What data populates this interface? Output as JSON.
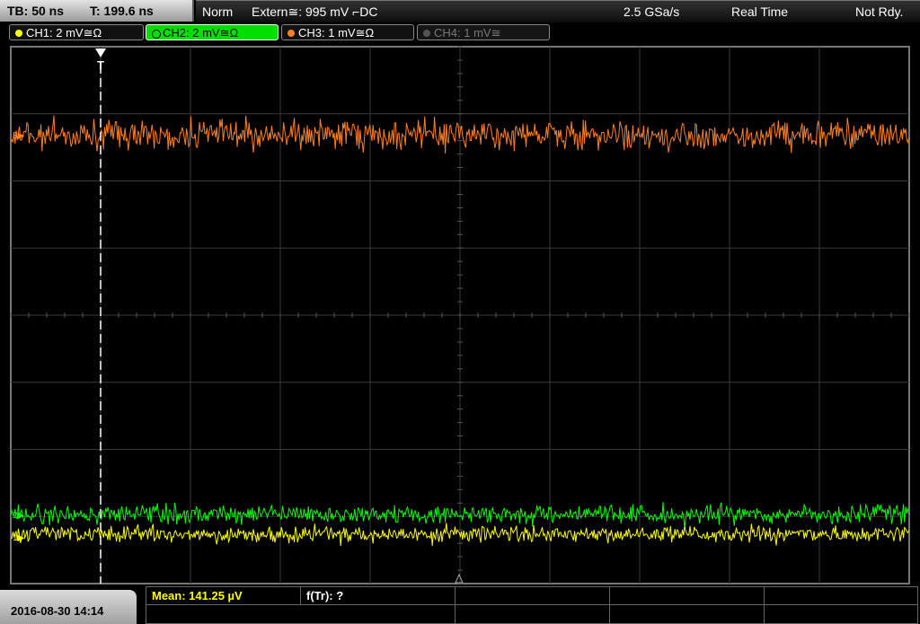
{
  "header": {
    "timebase": "TB: 50 ns",
    "trigger_pos": "T: 199.6 ns",
    "mode": "Norm",
    "trigger_source": "Extern≅: 995 mV ⌐DC",
    "sample_rate": "2.5 GSa/s",
    "acq_mode": "Real Time",
    "status": "Not Rdy."
  },
  "channels": [
    {
      "label": "CH1: 2 mV≅Ω",
      "color": "#ffff00",
      "active": true
    },
    {
      "label": "CH2: 2 mV≅Ω",
      "color": "#00ff00",
      "active": true,
      "selected": true
    },
    {
      "label": "CH3: 1 mV≅Ω",
      "color": "#ff8020",
      "active": true
    },
    {
      "label": "CH4: 1 mV≅",
      "color": "#777777",
      "active": false
    }
  ],
  "markers": {
    "trigger": "T"
  },
  "footer": {
    "datetime": "2016-08-30 14:14",
    "mean": "Mean: 141.25 µV",
    "frequency": "f(Tr): ?"
  }
}
